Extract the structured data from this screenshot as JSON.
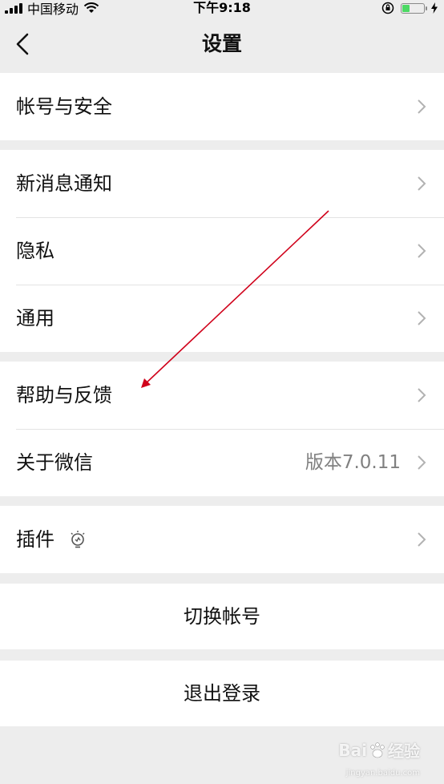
{
  "status_bar": {
    "carrier": "中国移动",
    "time": "下午9:18",
    "icons": [
      "signal-icon",
      "wifi-icon",
      "orientation-lock-icon",
      "battery-icon",
      "charging-icon"
    ]
  },
  "nav": {
    "title": "设置",
    "back_icon": "chevron-left-icon"
  },
  "groups": [
    {
      "items": [
        {
          "label": "帐号与安全"
        }
      ]
    },
    {
      "items": [
        {
          "label": "新消息通知"
        },
        {
          "label": "隐私"
        },
        {
          "label": "通用"
        }
      ]
    },
    {
      "items": [
        {
          "label": "帮助与反馈"
        },
        {
          "label": "关于微信",
          "value": "版本7.0.11"
        }
      ]
    },
    {
      "items": [
        {
          "label": "插件",
          "icon": "lightbulb-icon"
        }
      ]
    }
  ],
  "actions": {
    "switch_account": "切换帐号",
    "logout": "退出登录"
  },
  "watermark": {
    "brand": "Bai",
    "suffix": "经验",
    "url": "jingyan.baidu.com"
  },
  "colors": {
    "background": "#ededed",
    "row_background": "#ffffff",
    "separator": "#e3e3e3",
    "secondary_text": "#808080",
    "chevron": "#b2b2b2",
    "annotation_arrow": "#d0021b"
  }
}
